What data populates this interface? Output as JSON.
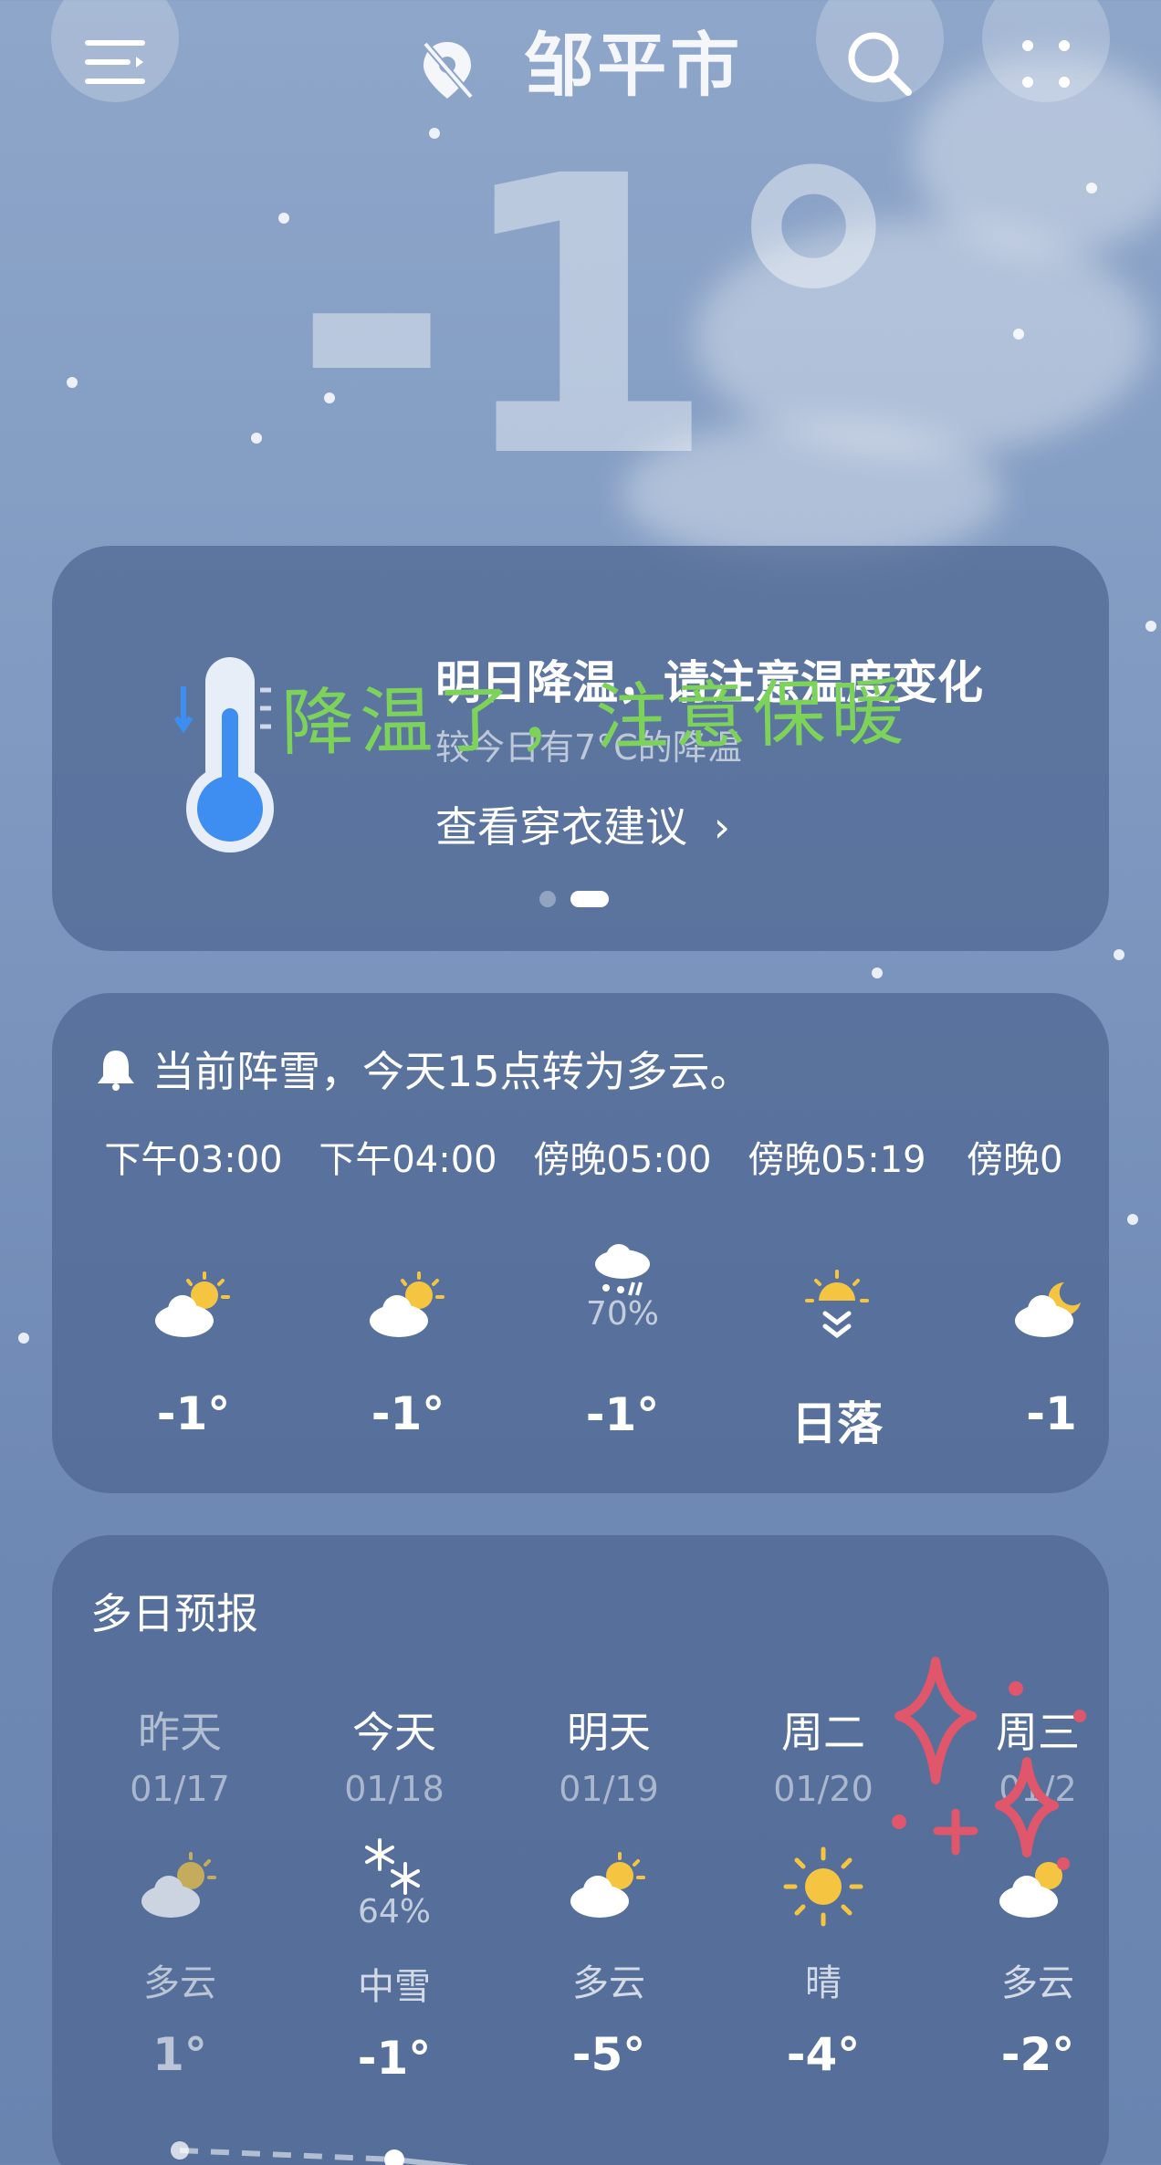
{
  "header": {
    "city": "邹平市",
    "current_temp": "-1°"
  },
  "alert_card": {
    "title": "明日降温，请注意温度变化",
    "subtitle": "较今日有7°C的降温",
    "link": "查看穿衣建议",
    "chevron": "›",
    "handwriting": "降温了，注意保暖"
  },
  "hourly": {
    "summary": "当前阵雪，今天15点转为多云。",
    "items": [
      {
        "time": "下午03:00",
        "icon": "partly-cloudy-icon",
        "pop": "",
        "temp": "-1°"
      },
      {
        "time": "下午04:00",
        "icon": "partly-cloudy-icon",
        "pop": "",
        "temp": "-1°"
      },
      {
        "time": "傍晚05:00",
        "icon": "snow-cloud-icon",
        "pop": "70%",
        "temp": "-1°"
      },
      {
        "time": "傍晚05:19",
        "icon": "sunset-icon",
        "pop": "",
        "temp": "日落"
      },
      {
        "time": "傍晚0",
        "icon": "moon-cloud-icon",
        "pop": "",
        "temp": "-1"
      }
    ]
  },
  "daily": {
    "title": "多日预报",
    "items": [
      {
        "day": "昨天",
        "date": "01/17",
        "icon": "partly-cloudy-icon",
        "pop": "",
        "cond": "多云",
        "temp": "1°"
      },
      {
        "day": "今天",
        "date": "01/18",
        "icon": "snowflake-icon",
        "pop": "64%",
        "cond": "中雪",
        "temp": "-1°"
      },
      {
        "day": "明天",
        "date": "01/19",
        "icon": "partly-cloudy-icon",
        "pop": "",
        "cond": "多云",
        "temp": "-5°"
      },
      {
        "day": "周二",
        "date": "01/20",
        "icon": "sun-icon",
        "pop": "",
        "cond": "晴",
        "temp": "-4°"
      },
      {
        "day": "周三",
        "date": "01/2",
        "icon": "partly-cloudy-icon",
        "pop": "",
        "cond": "多云",
        "temp": "-2°"
      }
    ]
  },
  "colors": {
    "accent_sun": "#f5c542",
    "handwriting_green": "#7dd35a",
    "sparkle_red": "#e0566b",
    "thermo_blue": "#3d8ef0"
  }
}
